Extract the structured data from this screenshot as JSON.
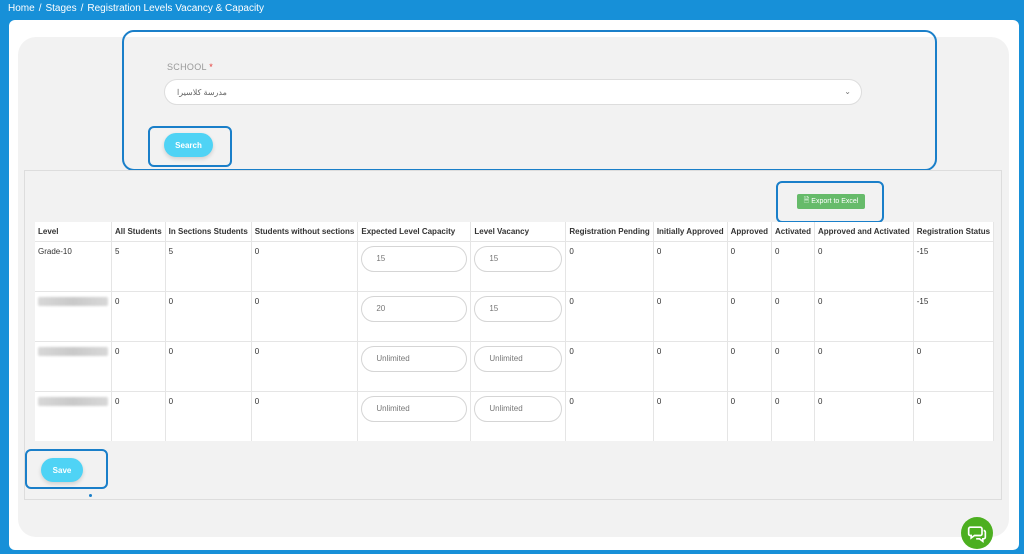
{
  "breadcrumb": [
    "Home",
    "Stages",
    "Registration Levels Vacancy & Capacity"
  ],
  "breadcrumb_separator": "/",
  "filter": {
    "school_label": "SCHOOL",
    "required_mark": "*",
    "school_value": "مدرسة كلاسيرا",
    "search_label": "Search"
  },
  "table": {
    "export_label": "Export to Excel",
    "columns": [
      "Level",
      "All Students",
      "In Sections Students",
      "Students without sections",
      "Expected Level Capacity",
      "Level Vacancy",
      "Registration Pending",
      "Initially Approved",
      "Approved",
      "Activated",
      "Approved and Activated",
      "Registration Status"
    ],
    "rows": [
      {
        "level": "Grade-10",
        "all": "5",
        "in_sections": "5",
        "without_sections": "0",
        "capacity": "15",
        "vacancy": "15",
        "pending": "0",
        "initially_approved": "0",
        "approved": "0",
        "activated": "0",
        "approved_activated": "0",
        "status": "-15"
      },
      {
        "level": "",
        "all": "0",
        "in_sections": "0",
        "without_sections": "0",
        "capacity": "20",
        "vacancy": "15",
        "pending": "0",
        "initially_approved": "0",
        "approved": "0",
        "activated": "0",
        "approved_activated": "0",
        "status": "-15"
      },
      {
        "level": "",
        "all": "0",
        "in_sections": "0",
        "without_sections": "0",
        "capacity": "Unlimited",
        "vacancy": "Unlimited",
        "pending": "0",
        "initially_approved": "0",
        "approved": "0",
        "activated": "0",
        "approved_activated": "0",
        "status": "0"
      },
      {
        "level": "",
        "all": "0",
        "in_sections": "0",
        "without_sections": "0",
        "capacity": "Unlimited",
        "vacancy": "Unlimited",
        "pending": "0",
        "initially_approved": "0",
        "approved": "0",
        "activated": "0",
        "approved_activated": "0",
        "status": "0"
      }
    ]
  },
  "save_label": "Save",
  "icons": {
    "chat": "chat-icon",
    "chevron": "chevron-down-icon",
    "excel": "file-excel-icon"
  }
}
